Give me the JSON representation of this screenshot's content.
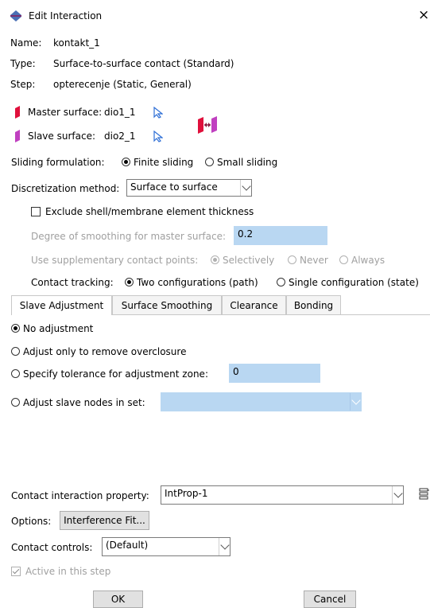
{
  "window": {
    "title": "Edit Interaction",
    "close_glyph": "×"
  },
  "info": {
    "name_label": "Name:",
    "name_value": "kontakt_1",
    "type_label": "Type:",
    "type_value": "Surface-to-surface contact (Standard)",
    "step_label": "Step:",
    "step_value": "opterecenje (Static, General)"
  },
  "surfaces": {
    "master_label": "Master surface:",
    "master_value": "dio1_1",
    "slave_label": "Slave surface:",
    "slave_value": "dio2_1",
    "master_color": "#e0103c",
    "slave_color": "#c040c0"
  },
  "sliding": {
    "label": "Sliding formulation:",
    "finite": "Finite sliding",
    "small": "Small sliding",
    "selected": "finite"
  },
  "discretization": {
    "label": "Discretization method:",
    "value": "Surface to surface"
  },
  "exclude_thickness": {
    "label": "Exclude shell/membrane element thickness",
    "checked": false
  },
  "smoothing": {
    "label": "Degree of smoothing for master surface:",
    "value": "0.2"
  },
  "supplementary": {
    "label": "Use supplementary contact points:",
    "selectively": "Selectively",
    "never": "Never",
    "always": "Always"
  },
  "tracking": {
    "label": "Contact tracking:",
    "two": "Two configurations (path)",
    "single": "Single configuration (state)"
  },
  "tabs": [
    "Slave Adjustment",
    "Surface Smoothing",
    "Clearance",
    "Bonding"
  ],
  "adjustment": {
    "no_adjustment": "No adjustment",
    "remove_overclosure": "Adjust only to remove overclosure",
    "tolerance_label": "Specify tolerance for adjustment zone:",
    "tolerance_value": "0",
    "nodes_label": "Adjust slave nodes in set:",
    "nodes_value": ""
  },
  "property": {
    "label": "Contact interaction property:",
    "value": "IntProp-1"
  },
  "options": {
    "label": "Options:",
    "button": "Interference Fit..."
  },
  "controls": {
    "label": "Contact controls:",
    "value": "(Default)"
  },
  "active": {
    "label": "Active in this step",
    "checked": true
  },
  "buttons": {
    "ok": "OK",
    "cancel": "Cancel"
  }
}
